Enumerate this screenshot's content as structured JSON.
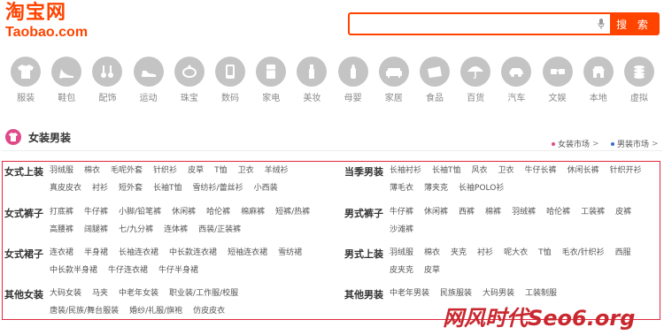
{
  "logo": {
    "cn": "淘宝网",
    "en": "Taobao.com"
  },
  "search": {
    "value": "",
    "placeholder": "",
    "button": "搜 索",
    "accent": "#ff4400"
  },
  "categories": [
    {
      "label": "服装",
      "icon": "shirt-icon"
    },
    {
      "label": "鞋包",
      "icon": "high-heel-icon"
    },
    {
      "label": "配饰",
      "icon": "accessory-icon"
    },
    {
      "label": "运动",
      "icon": "sneaker-icon"
    },
    {
      "label": "珠宝",
      "icon": "ring-icon"
    },
    {
      "label": "数码",
      "icon": "phone-icon"
    },
    {
      "label": "家电",
      "icon": "appliance-icon"
    },
    {
      "label": "美妆",
      "icon": "cosmetics-icon"
    },
    {
      "label": "母婴",
      "icon": "baby-bottle-icon"
    },
    {
      "label": "家居",
      "icon": "sofa-icon"
    },
    {
      "label": "食品",
      "icon": "food-icon"
    },
    {
      "label": "百货",
      "icon": "umbrella-icon"
    },
    {
      "label": "汽车",
      "icon": "car-icon"
    },
    {
      "label": "文娱",
      "icon": "glasses-icon"
    },
    {
      "label": "本地",
      "icon": "local-icon"
    },
    {
      "label": "虚拟",
      "icon": "coins-icon"
    }
  ],
  "section": {
    "title": "女装男装",
    "markets": [
      {
        "label": "女装市场",
        "arrow": ">"
      },
      {
        "label": "男装市场",
        "arrow": ">"
      }
    ]
  },
  "groups": [
    {
      "title": "女式上装",
      "rows": [
        [
          "羽绒服",
          "棉衣",
          "毛呢外套",
          "针织衫",
          "皮草",
          "T恤",
          "卫衣",
          "羊绒衫"
        ],
        [
          "真皮皮衣",
          "衬衫",
          "短外套",
          "长袖T恤",
          "雪纺衫/蕾丝衫",
          "小西装"
        ]
      ]
    },
    {
      "title": "当季男装",
      "rows": [
        [
          "长袖衬衫",
          "长袖T恤",
          "风衣",
          "卫衣",
          "牛仔长裤",
          "休闲长裤",
          "针织开衫"
        ],
        [
          "薄毛衣",
          "薄夹克",
          "长袖POLO衫"
        ]
      ]
    },
    {
      "title": "女式裤子",
      "rows": [
        [
          "打底裤",
          "牛仔裤",
          "小脚/铅笔裤",
          "休闲裤",
          "哈伦裤",
          "棉麻裤",
          "短裤/热裤"
        ],
        [
          "高腰裤",
          "阔腿裤",
          "七/九分裤",
          "连体裤",
          "西装/正装裤"
        ]
      ]
    },
    {
      "title": "男式裤子",
      "rows": [
        [
          "牛仔裤",
          "休闲裤",
          "西裤",
          "棉裤",
          "羽绒裤",
          "哈伦裤",
          "工装裤",
          "皮裤"
        ],
        [
          "沙滩裤"
        ]
      ]
    },
    {
      "title": "女式裙子",
      "rows": [
        [
          "连衣裙",
          "半身裙",
          "长袖连衣裙",
          "中长款连衣裙",
          "短袖连衣裙",
          "雪纺裙"
        ],
        [
          "中长款半身裙",
          "牛仔连衣裙",
          "牛仔半身裙"
        ]
      ]
    },
    {
      "title": "男式上装",
      "rows": [
        [
          "羽绒服",
          "棉衣",
          "夹克",
          "衬衫",
          "呢大衣",
          "T恤",
          "毛衣/针织衫",
          "西服"
        ],
        [
          "皮夹克",
          "皮草"
        ]
      ]
    },
    {
      "title": "其他女装",
      "rows": [
        [
          "大码女装",
          "马夹",
          "中老年女装",
          "职业装/工作服/校服"
        ],
        [
          "唐装/民族/舞台服装",
          "婚纱/礼服/旗袍",
          "仿皮皮衣"
        ]
      ]
    },
    {
      "title": "其他男装",
      "rows": [
        [
          "中老年男装",
          "民族服装",
          "大码男装",
          "工装制服"
        ]
      ]
    }
  ],
  "watermark": "网风时代Seo6.org"
}
